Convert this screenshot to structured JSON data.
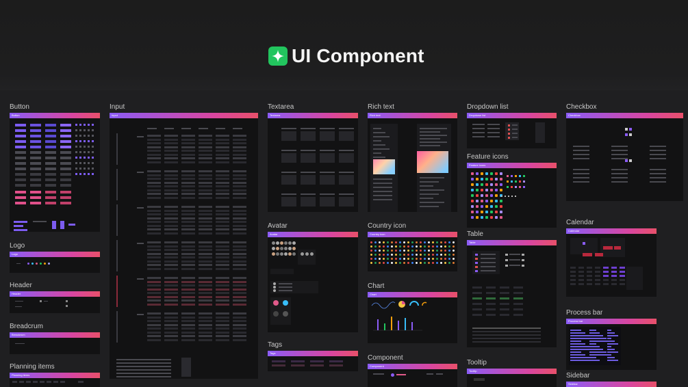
{
  "page": {
    "title": "UI Component",
    "title_icon": "sparkle-icon",
    "accent": "#22c55e"
  },
  "gradient": {
    "start": "#8b5cf6",
    "mid": "#d946a0",
    "end": "#e8506a"
  },
  "frames": {
    "button": {
      "label": "Button",
      "bar": "Button"
    },
    "input": {
      "label": "Input",
      "bar": "Input"
    },
    "textarea": {
      "label": "Textarea",
      "bar": "Textarea"
    },
    "richtext": {
      "label": "Rich text",
      "bar": "Rich text"
    },
    "dropdown": {
      "label": "Dropdown list",
      "bar": "Dropdown list"
    },
    "checkbox": {
      "label": "Checkbox",
      "bar": "Checkbox"
    },
    "feature": {
      "label": "Feature icons",
      "bar": "Feature icons"
    },
    "logo": {
      "label": "Logo",
      "bar": "Logo"
    },
    "avatar": {
      "label": "Avatar",
      "bar": "Avatar"
    },
    "country": {
      "label": "Country icon",
      "bar": "Country icon"
    },
    "table": {
      "label": "Table",
      "bar": "Table"
    },
    "calendar": {
      "label": "Calendar",
      "bar": "Calendar"
    },
    "header": {
      "label": "Header",
      "bar": "Header"
    },
    "chart": {
      "label": "Chart",
      "bar": "Chart"
    },
    "breadcrum": {
      "label": "Breadcrum",
      "bar": "Breadcrum"
    },
    "process": {
      "label": "Process bar",
      "bar": "Process bar"
    },
    "tags": {
      "label": "Tags",
      "bar": "Tags"
    },
    "component": {
      "label": "Component",
      "bar": "Component"
    },
    "tooltip": {
      "label": "Tooltip",
      "bar": "Tooltip"
    },
    "planning": {
      "label": "Planning items",
      "bar": "Planning items"
    },
    "sidebar": {
      "label": "Sidebar",
      "bar": "Sidebar"
    }
  }
}
